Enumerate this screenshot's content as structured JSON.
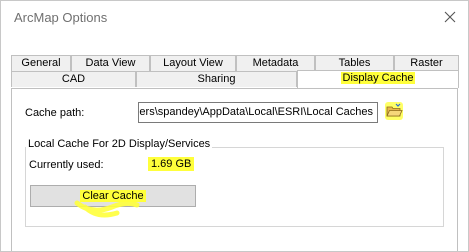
{
  "window": {
    "title": "ArcMap Options",
    "close_icon": "close-icon"
  },
  "tabs_row1": [
    {
      "label": "General"
    },
    {
      "label": "Data View"
    },
    {
      "label": "Layout View"
    },
    {
      "label": "Metadata"
    },
    {
      "label": "Tables"
    },
    {
      "label": "Raster"
    }
  ],
  "tabs_row2": [
    {
      "label": "CAD"
    },
    {
      "label": "Sharing"
    },
    {
      "label": "Display Cache",
      "active": true
    }
  ],
  "display_cache": {
    "cache_path_label": "Cache path:",
    "cache_path_value": "Jsers\\spandey\\AppData\\Local\\ESRI\\Local Caches",
    "browse_icon": "folder-open-icon",
    "group_title": "Local Cache For 2D Display/Services",
    "currently_used_label": "Currently used:",
    "currently_used_value": "1.69 GB",
    "clear_button_label": "Clear Cache"
  },
  "colors": {
    "highlight": "#ffff3b",
    "tab_bg": "#f0f0f0",
    "border": "#c0c0c0"
  }
}
